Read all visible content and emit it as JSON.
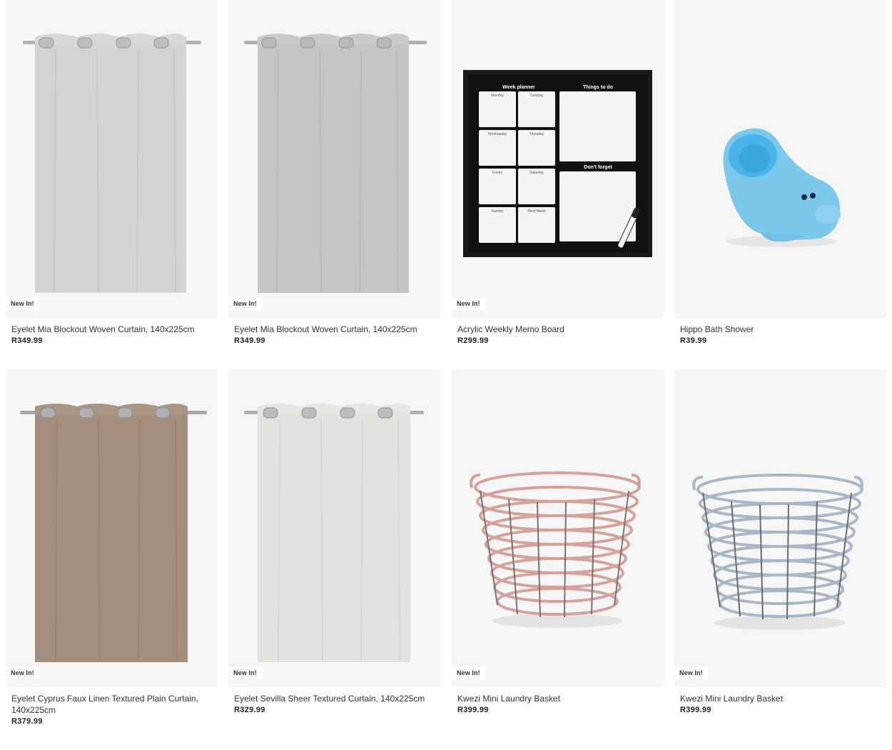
{
  "products": [
    {
      "name": "Eyelet Mia Blockout Woven Curtain, 140x225cm",
      "price": "R349.99",
      "badge": "New In!",
      "image_icon": "grey-curtain-image"
    },
    {
      "name": "Eyelet Mia Blockout Woven Curtain, 140x225cm",
      "price": "R349.99",
      "badge": "New In!",
      "image_icon": "grey-curtain-image"
    },
    {
      "name": "Acrylic Weekly Memo Board",
      "price": "R299.99",
      "badge": "New In!",
      "image_icon": "memo-board-image"
    },
    {
      "name": "Hippo Bath Shower",
      "price": "R39.99",
      "badge": "",
      "image_icon": "hippo-toy-image"
    },
    {
      "name": "Eyelet Cyprus Faux Linen Textured Plain Curtain, 140x225cm",
      "price": "R379.99",
      "badge": "New In!",
      "image_icon": "taupe-curtain-image"
    },
    {
      "name": "Eyelet Sevilla Sheer Textured Curtain, 140x225cm",
      "price": "R329.99",
      "badge": "New In!",
      "image_icon": "sheer-curtain-image"
    },
    {
      "name": "Kwezi Mini Laundry Basket",
      "price": "R399.99",
      "badge": "New In!",
      "image_icon": "pink-basket-image"
    },
    {
      "name": "Kwezi Mini Laundry Basket",
      "price": "R399.99",
      "badge": "New In!",
      "image_icon": "blue-basket-image"
    }
  ],
  "memo_board": {
    "week_title": "Week planner",
    "todo_title": "Things to do",
    "forget_title": "Don't forget",
    "days": [
      "Monday",
      "Tuesday",
      "Wednesday",
      "Thursday",
      "Friday",
      "Saturday",
      "Sunday",
      "Next Week"
    ]
  },
  "colors": {
    "badge_bg": "#ffffff",
    "card_bg": "#f6f6f6",
    "curtain_grey": "#d6d6d4",
    "curtain_taupe": "#a89484",
    "hippo_blue": "#7cc7ec",
    "basket_pink": "#d6a39a",
    "basket_blue": "#a9b8c8"
  }
}
